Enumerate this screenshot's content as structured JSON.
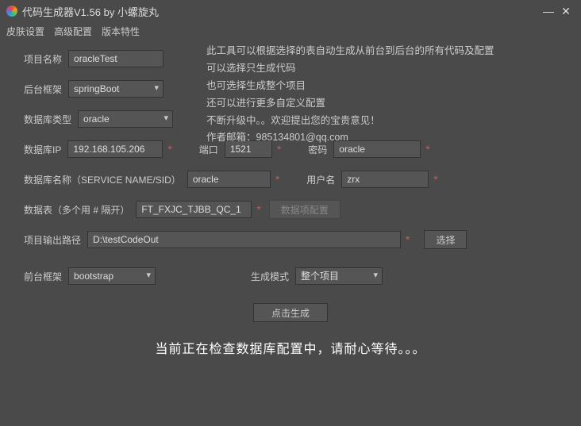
{
  "window": {
    "title": "代码生成器V1.56 by 小螺旋丸"
  },
  "menu": {
    "skin": "皮肤设置",
    "advanced": "高级配置",
    "version": "版本特性"
  },
  "labels": {
    "projectName": "项目名称",
    "backendFramework": "后台框架",
    "dbType": "数据库类型",
    "dbIp": "数据库IP",
    "port": "端口",
    "password": "密码",
    "dbName": "数据库名称（SERVICE NAME/SID）",
    "username": "用户名",
    "tables": "数据表（多个用 # 隔开）",
    "dataConfig": "数据项配置",
    "outputPath": "项目输出路径",
    "choose": "选择",
    "frontFramework": "前台框架",
    "genMode": "生成模式",
    "generate": "点击生成"
  },
  "values": {
    "projectName": "oracleTest",
    "backendFramework": "springBoot",
    "dbType": "oracle",
    "dbIp": "192.168.105.206",
    "port": "1521",
    "password": "oracle",
    "dbName": "oracle",
    "username": "zrx",
    "tables": "FT_FXJC_TJBB_QC_1",
    "outputPath": "D:\\testCodeOut",
    "frontFramework": "bootstrap",
    "genMode": "整个项目"
  },
  "description": {
    "l1": "此工具可以根据选择的表自动生成从前台到后台的所有代码及配置",
    "l2": "可以选择只生成代码",
    "l3": "也可选择生成整个项目",
    "l4": "还可以进行更多自定义配置",
    "l5": "不断升级中。。欢迎提出您的宝贵意见！",
    "l6": "作者邮箱：985134801@qq.com"
  },
  "status": "当前正在检查数据库配置中，请耐心等待。。。"
}
